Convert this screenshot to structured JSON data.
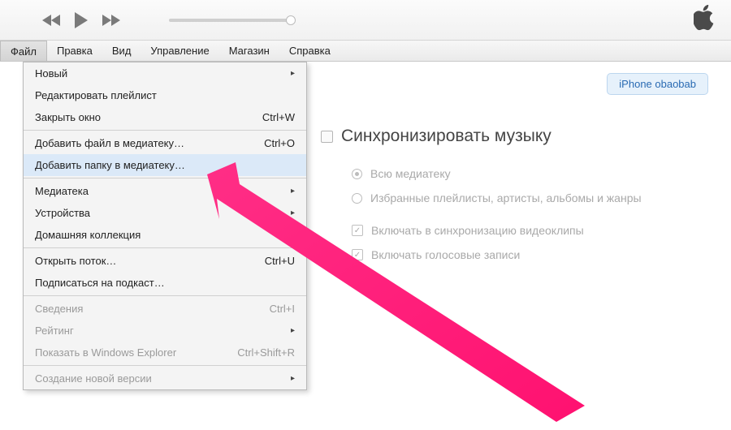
{
  "menubar": {
    "items": [
      "Файл",
      "Правка",
      "Вид",
      "Управление",
      "Магазин",
      "Справка"
    ],
    "active_index": 0
  },
  "dropdown": {
    "rows": [
      {
        "label": "Новый",
        "shortcut": "",
        "submenu": true
      },
      {
        "label": "Редактировать плейлист",
        "shortcut": ""
      },
      {
        "label": "Закрыть окно",
        "shortcut": "Ctrl+W"
      },
      {
        "sep": true
      },
      {
        "label": "Добавить файл в медиатеку…",
        "shortcut": "Ctrl+O"
      },
      {
        "label": "Добавить папку в медиатеку…",
        "shortcut": "",
        "highlight": true
      },
      {
        "sep": true
      },
      {
        "label": "Медиатека",
        "shortcut": "",
        "submenu": true
      },
      {
        "label": "Устройства",
        "shortcut": "",
        "submenu": true
      },
      {
        "label": "Домашняя коллекция",
        "shortcut": ""
      },
      {
        "sep": true
      },
      {
        "label": "Открыть поток…",
        "shortcut": "Ctrl+U"
      },
      {
        "label": "Подписаться на подкаст…",
        "shortcut": ""
      },
      {
        "sep": true
      },
      {
        "label": "Сведения",
        "shortcut": "Ctrl+I",
        "disabled": true
      },
      {
        "label": "Рейтинг",
        "shortcut": "",
        "submenu": true,
        "disabled": true
      },
      {
        "label": "Показать в Windows Explorer",
        "shortcut": "Ctrl+Shift+R",
        "disabled": true
      },
      {
        "sep": true
      },
      {
        "label": "Создание новой версии",
        "shortcut": "",
        "submenu": true,
        "disabled": true
      }
    ]
  },
  "device": {
    "name": "iPhone obaobab"
  },
  "sync": {
    "title": "Синхронизировать музыку",
    "opt_all": "Всю медиатеку",
    "opt_selected": "Избранные плейлисты, артисты, альбомы и жанры",
    "opt_video": "Включать в синхронизацию видеоклипы",
    "opt_voice": "Включать голосовые записи"
  }
}
